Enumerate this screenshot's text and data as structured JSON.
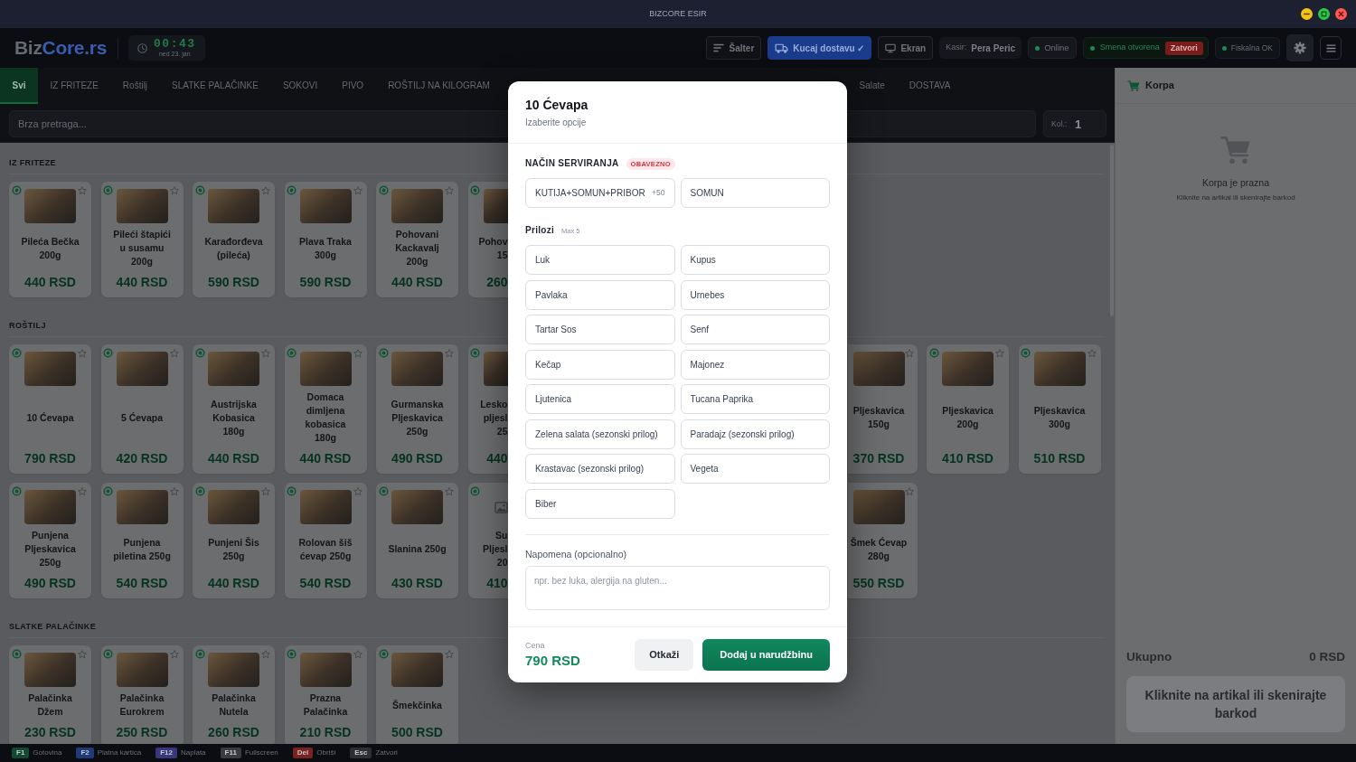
{
  "window": {
    "title": "BIZCORE ESIR"
  },
  "header": {
    "logo": {
      "lead": "Biz",
      "accent": "Core.rs"
    },
    "clock": {
      "time": "00:43",
      "date": "ned 23. jan"
    },
    "buttons": [
      {
        "label": "Šalter",
        "kind": "secondary"
      },
      {
        "label": "Kucaj dostavu ✓",
        "kind": "primary"
      },
      {
        "label": "Ekran",
        "kind": "secondary"
      }
    ],
    "cashier": {
      "label": "Kasir:",
      "name": "Pera Peric"
    },
    "statuses": [
      {
        "label": "Online",
        "kind": "plain"
      },
      {
        "label": "Smena otvorena",
        "kind": "shift",
        "action": "Zatvori"
      },
      {
        "label": "Fiskalna OK",
        "kind": "muted"
      }
    ]
  },
  "categories": [
    {
      "label": "Svi",
      "selected": true,
      "kind": "tab"
    },
    {
      "label": "IZ FRITEZE",
      "selected": false,
      "kind": "tab"
    },
    {
      "label": "Roštilj",
      "selected": false,
      "kind": "tab"
    },
    {
      "label": "SLATKE PALAČINKE",
      "selected": false,
      "kind": "tab"
    },
    {
      "label": "SOKOVI",
      "selected": false,
      "kind": "tab"
    },
    {
      "label": "PIVO",
      "selected": false,
      "kind": "tab"
    },
    {
      "label": "ROŠTILJ NA KILOGRAM",
      "selected": false,
      "kind": "tab"
    },
    {
      "label": "Salate",
      "selected": false,
      "kind": "tab_past_dialog"
    },
    {
      "label": "DOSTAVA",
      "selected": false,
      "kind": "tab_past_dialog"
    }
  ],
  "search": {
    "placeholder": "Brza pretraga...",
    "quantity_label": "Kol.:",
    "quantity": "1"
  },
  "sections": [
    {
      "title": "IZ FRITEZE",
      "items": [
        {
          "name": "Pileća Bečka 200g",
          "price": "440 RSD",
          "kind": "card",
          "photo": true
        },
        {
          "name": "Pileći štapići u susamu 200g",
          "price": "440 RSD",
          "kind": "card",
          "photo": true
        },
        {
          "name": "Karađorđeva (pileća)",
          "price": "590 RSD",
          "kind": "card",
          "photo": true
        },
        {
          "name": "Plava Traka 300g",
          "price": "590 RSD",
          "kind": "card",
          "photo": true
        },
        {
          "name": "Pohovani Kackavalj 200g",
          "price": "440 RSD",
          "kind": "card",
          "photo": true
        },
        {
          "name": "Pohov 15",
          "price": "260",
          "kind": "card_cut_right",
          "photo": true
        }
      ]
    },
    {
      "title": "ROŠTILJ",
      "items": [
        {
          "name": "10 Ćevapa",
          "price": "790 RSD",
          "kind": "card",
          "photo": true
        },
        {
          "name": "5 Ćevapa",
          "price": "420 RSD",
          "kind": "card",
          "photo": true
        },
        {
          "name": "Austrijska Kobasica 180g",
          "price": "440 RSD",
          "kind": "card",
          "photo": true
        },
        {
          "name": "Domaca dimljena kobasica 180g",
          "price": "440 RSD",
          "kind": "card",
          "photo": true
        },
        {
          "name": "Gurmanska Pljeskavica 250g",
          "price": "490 RSD",
          "kind": "card",
          "photo": true
        },
        {
          "name": "Lesko pljesl 25",
          "price": "440",
          "kind": "card_cut_right",
          "photo": true
        },
        {
          "name": "Pljeskavica 150g",
          "price": "370 RSD",
          "kind": "card_past_dialog",
          "photo": true
        },
        {
          "name": "Pljeskavica 200g",
          "price": "410 RSD",
          "kind": "card",
          "photo": true
        },
        {
          "name": "Pljeskavica 300g",
          "price": "510 RSD",
          "kind": "card",
          "photo": true
        },
        {
          "name": "Punjena Pljeskavica 250g",
          "price": "490 RSD",
          "kind": "card",
          "photo": true
        },
        {
          "name": "Punjena piletina 250g",
          "price": "540 RSD",
          "kind": "card",
          "photo": true
        },
        {
          "name": "Punjeni Šis 250g",
          "price": "440 RSD",
          "kind": "card",
          "photo": true
        },
        {
          "name": "Rolovan šiš ćevap 250g",
          "price": "540 RSD",
          "kind": "card",
          "photo": true
        },
        {
          "name": "Slanina 250g",
          "price": "430 RSD",
          "kind": "card",
          "photo": true
        },
        {
          "name": "Su Pljesl 20",
          "price": "410",
          "kind": "card_cut_right",
          "photo": false
        },
        {
          "name": "Šmek Ćevap 280g",
          "price": "550 RSD",
          "kind": "card_past_dialog",
          "photo": true
        }
      ]
    },
    {
      "title": "SLATKE PALAČINKE",
      "items": [
        {
          "name": "Palačinka Džem",
          "price": "230 RSD",
          "kind": "card",
          "photo": true
        },
        {
          "name": "Palačinka Eurokrem",
          "price": "250 RSD",
          "kind": "card",
          "photo": true
        },
        {
          "name": "Palačinka Nutela",
          "price": "260 RSD",
          "kind": "card",
          "photo": true
        },
        {
          "name": "Prazna Palačinka",
          "price": "210 RSD",
          "kind": "card",
          "photo": true
        },
        {
          "name": "Šmekčinka",
          "price": "500 RSD",
          "kind": "card",
          "photo": true
        }
      ]
    }
  ],
  "cart": {
    "title": "Korpa",
    "empty_title": "Korpa je prazna",
    "empty_hint": "Kliknite na artikal ili skenirajte barkod",
    "total_label": "Ukupno",
    "total": "0 RSD",
    "checkout": {
      "label": "Kliknite na artikal ili skenirajte barkod",
      "disabled": true
    }
  },
  "shortcuts": [
    {
      "key": "F1",
      "label": "Gotovina",
      "color": "#114a30"
    },
    {
      "key": "F2",
      "label": "Platna kartica",
      "color": "#1e3b78"
    },
    {
      "key": "F12",
      "label": "Naplata",
      "color": "#38377e"
    },
    {
      "key": "F11",
      "label": "Fullscreen",
      "color": "#3a3b40"
    },
    {
      "key": "Del",
      "label": "Obriši",
      "color": "#7a2220"
    },
    {
      "key": "Esc",
      "label": "Zatvori",
      "color": "#2e2f33"
    }
  ],
  "dialog": {
    "title": "10 Ćevapa",
    "subtitle": "Izaberite opcije",
    "groups": [
      {
        "title": "NAČIN SERVIRANJA",
        "badge": "OBAVEZNO",
        "options": [
          {
            "label": "KUTIJA+SOMUN+PRIBOR",
            "surcharge": "+50",
            "selected": false
          },
          {
            "label": "SOMUN",
            "selected": false
          }
        ]
      },
      {
        "title": "Prilozi",
        "hint": "Max 5",
        "options": [
          {
            "label": "Luk",
            "selected": false
          },
          {
            "label": "Kupus",
            "selected": false
          },
          {
            "label": "Pavlaka",
            "selected": false
          },
          {
            "label": "Urnebes",
            "selected": false
          },
          {
            "label": "Tartar Sos",
            "selected": false
          },
          {
            "label": "Senf",
            "selected": false
          },
          {
            "label": "Kečap",
            "selected": false
          },
          {
            "label": "Majonez",
            "selected": false
          },
          {
            "label": "Ljutenica",
            "selected": false
          },
          {
            "label": "Tucana Paprika",
            "selected": false
          },
          {
            "label": "Zelena salata (sezonski prilog)",
            "selected": false
          },
          {
            "label": "Paradajz (sezonski prilog)",
            "selected": false
          },
          {
            "label": "Krastavac (sezonski prilog)",
            "selected": false
          },
          {
            "label": "Vegeta",
            "selected": false
          },
          {
            "label": "Biber",
            "selected": false
          }
        ]
      }
    ],
    "note": {
      "label": "Napomena (opcionalno)",
      "placeholder": "npr. bez luka, alergija na gluten..."
    },
    "price_label": "Cena",
    "price": "790 RSD",
    "buttons": [
      {
        "label": "Otkaži",
        "kind": "secondary"
      },
      {
        "label": "Dodaj u narudžbinu",
        "kind": "primary"
      }
    ]
  }
}
